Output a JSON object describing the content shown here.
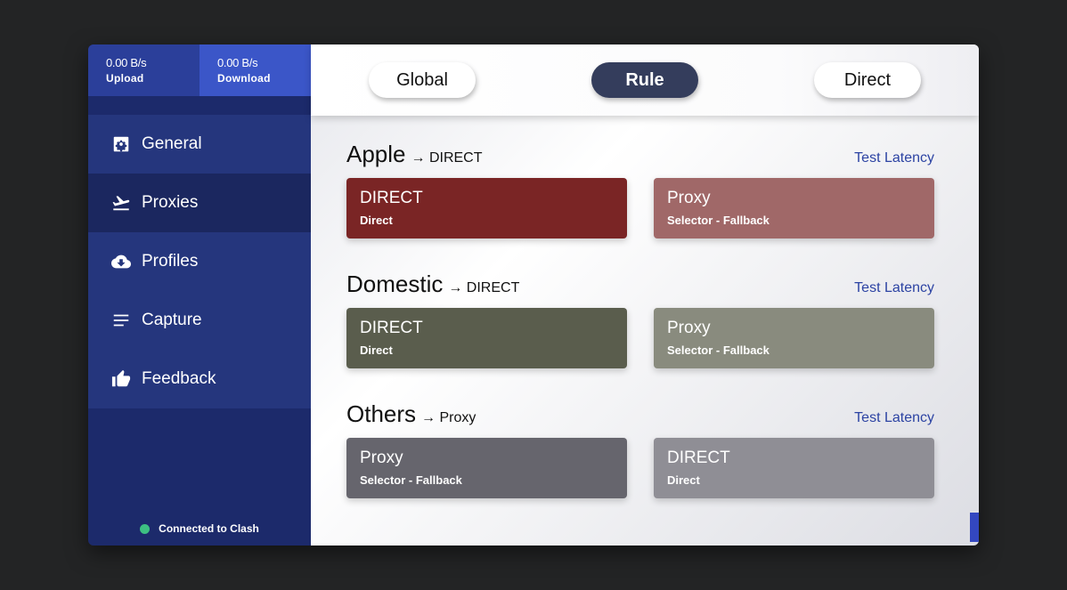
{
  "traffic": {
    "upload": {
      "rate": "0.00 B/s",
      "label": "Upload"
    },
    "download": {
      "rate": "0.00 B/s",
      "label": "Download"
    }
  },
  "nav": {
    "items": [
      {
        "label": "General",
        "icon": "gear-icon"
      },
      {
        "label": "Proxies",
        "icon": "plane-takeoff-icon"
      },
      {
        "label": "Profiles",
        "icon": "cloud-download-icon"
      },
      {
        "label": "Capture",
        "icon": "lines-icon"
      },
      {
        "label": "Feedback",
        "icon": "thumbs-up-icon"
      }
    ],
    "active": "Proxies"
  },
  "status": {
    "text": "Connected to Clash",
    "color": "#3dbf82"
  },
  "modes": {
    "items": [
      "Global",
      "Rule",
      "Direct"
    ],
    "active": "Rule"
  },
  "groups": [
    {
      "name": "Apple",
      "arrow": "→ DIRECT",
      "test_label": "Test Latency",
      "proxies": [
        {
          "name": "DIRECT",
          "type": "Direct",
          "color": "#7a2525"
        },
        {
          "name": "Proxy",
          "type": "Selector - Fallback",
          "color": "#a06868"
        }
      ]
    },
    {
      "name": "Domestic",
      "arrow": "→ DIRECT",
      "test_label": "Test Latency",
      "proxies": [
        {
          "name": "DIRECT",
          "type": "Direct",
          "color": "#5a5d4d"
        },
        {
          "name": "Proxy",
          "type": "Selector - Fallback",
          "color": "#898b7e"
        }
      ]
    },
    {
      "name": "Others",
      "arrow": "→ Proxy",
      "test_label": "Test Latency",
      "proxies": [
        {
          "name": "Proxy",
          "type": "Selector - Fallback",
          "color": "#66656d"
        },
        {
          "name": "DIRECT",
          "type": "Direct",
          "color": "#8f8e95"
        }
      ]
    }
  ],
  "colors": {
    "sidebar": "#1c2a6b",
    "upload_bg": "#2b3f9a",
    "download_bg": "#3b56c8",
    "accent": "#2c43a3",
    "active_mode": "#343d5c"
  }
}
